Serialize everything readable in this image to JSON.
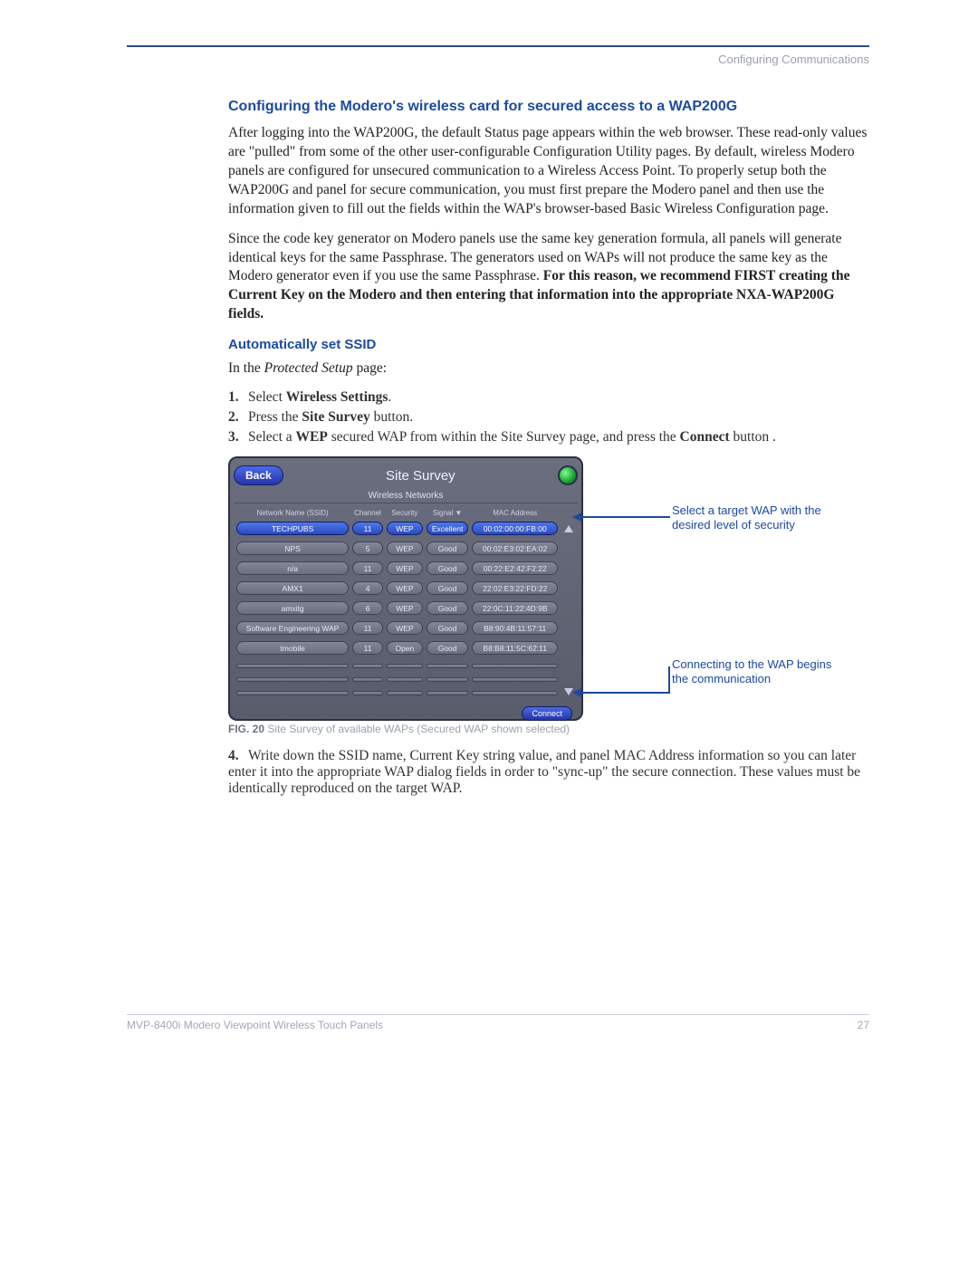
{
  "header": {
    "section": "Configuring Communications"
  },
  "headings": {
    "h1": "Configuring the Modero's wireless card for secured access to a WAP200G",
    "h2": "Automatically set SSID"
  },
  "paragraphs": {
    "p1": "After logging into the WAP200G, the default Status page appears within the web browser. These read-only values are \"pulled\" from some of the other user-configurable Configuration Utility pages. By default, wireless Modero panels are configured for unsecured communication to a Wireless Access Point. To properly setup both the WAP200G and panel for secure communication, you must first prepare the Modero panel and then use the information given to fill out the fields within the WAP's browser-based Basic Wireless Configuration page.",
    "p2a": "Since the code key generator on Modero panels use the same key generation formula, all panels will generate identical keys for the same Passphrase. The generators used on WAPs will not produce the same key as the Modero generator even if you use the same Passphrase. ",
    "p2b": "For this reason, we recommend FIRST creating the Current Key on the Modero and then entering that information into the appropriate NXA-WAP200G fields.",
    "intro": {
      "pre": "In the ",
      "mid": "Protected Setup",
      "post": " page:"
    }
  },
  "steps": {
    "s1": {
      "num": "1.",
      "a": "Select ",
      "b": "Wireless Settings",
      "c": "."
    },
    "s2": {
      "num": "2.",
      "a": "Press the ",
      "b": "Site Survey",
      "c": " button."
    },
    "s3": {
      "num": "3.",
      "a": "Select a ",
      "b": "WEP",
      "c": " secured WAP from within the Site Survey page, and press the ",
      "d": "Connect",
      "e": " button     ."
    },
    "s4": {
      "num": "4.",
      "text": "Write down the SSID name, Current Key string value, and panel MAC Address information so you can later enter it into the appropriate WAP dialog fields in order to \"sync-up\" the secure connection. These values must be identically reproduced on the target WAP."
    }
  },
  "figure": {
    "back": "Back",
    "title": "Site Survey",
    "subtitle": "Wireless Networks",
    "connect": "Connect",
    "columns": {
      "ssid": "Network Name (SSID)",
      "ch": "Channel",
      "sec": "Security",
      "sig": "Signal ▼",
      "mac": "MAC Address"
    },
    "rows": [
      {
        "ssid": "TECHPUBS",
        "ch": "11",
        "sec": "WEP",
        "sig": "Excellent",
        "mac": "00:02:00:00:FB:00",
        "selected": true
      },
      {
        "ssid": "NPS",
        "ch": "5",
        "sec": "WEP",
        "sig": "Good",
        "mac": "00:02:E3:02:EA:02"
      },
      {
        "ssid": "n/a",
        "ch": "11",
        "sec": "WEP",
        "sig": "Good",
        "mac": "00:22:E2:42:F2:22"
      },
      {
        "ssid": "AMX1",
        "ch": "4",
        "sec": "WEP",
        "sig": "Good",
        "mac": "22:02:E3:22:FD:22"
      },
      {
        "ssid": "amxitg",
        "ch": "6",
        "sec": "WEP",
        "sig": "Good",
        "mac": "22:0C:11:22:4D:9B"
      },
      {
        "ssid": "Software Engineering WAP",
        "ch": "11",
        "sec": "WEP",
        "sig": "Good",
        "mac": "B8:90:4B:11:57:11"
      },
      {
        "ssid": "tmobile",
        "ch": "11",
        "sec": "Open",
        "sig": "Good",
        "mac": "B8:B8:11:5C:62:11"
      }
    ],
    "callout1": "Select a target WAP with the desired level of security",
    "callout2": "Connecting to the WAP begins the communication",
    "caption_label": "FIG. 20",
    "caption_text": "  Site Survey of available WAPs (Secured WAP shown selected)"
  },
  "footer": {
    "left": "MVP-8400i Modero Viewpoint Wireless Touch Panels",
    "right": "27"
  }
}
